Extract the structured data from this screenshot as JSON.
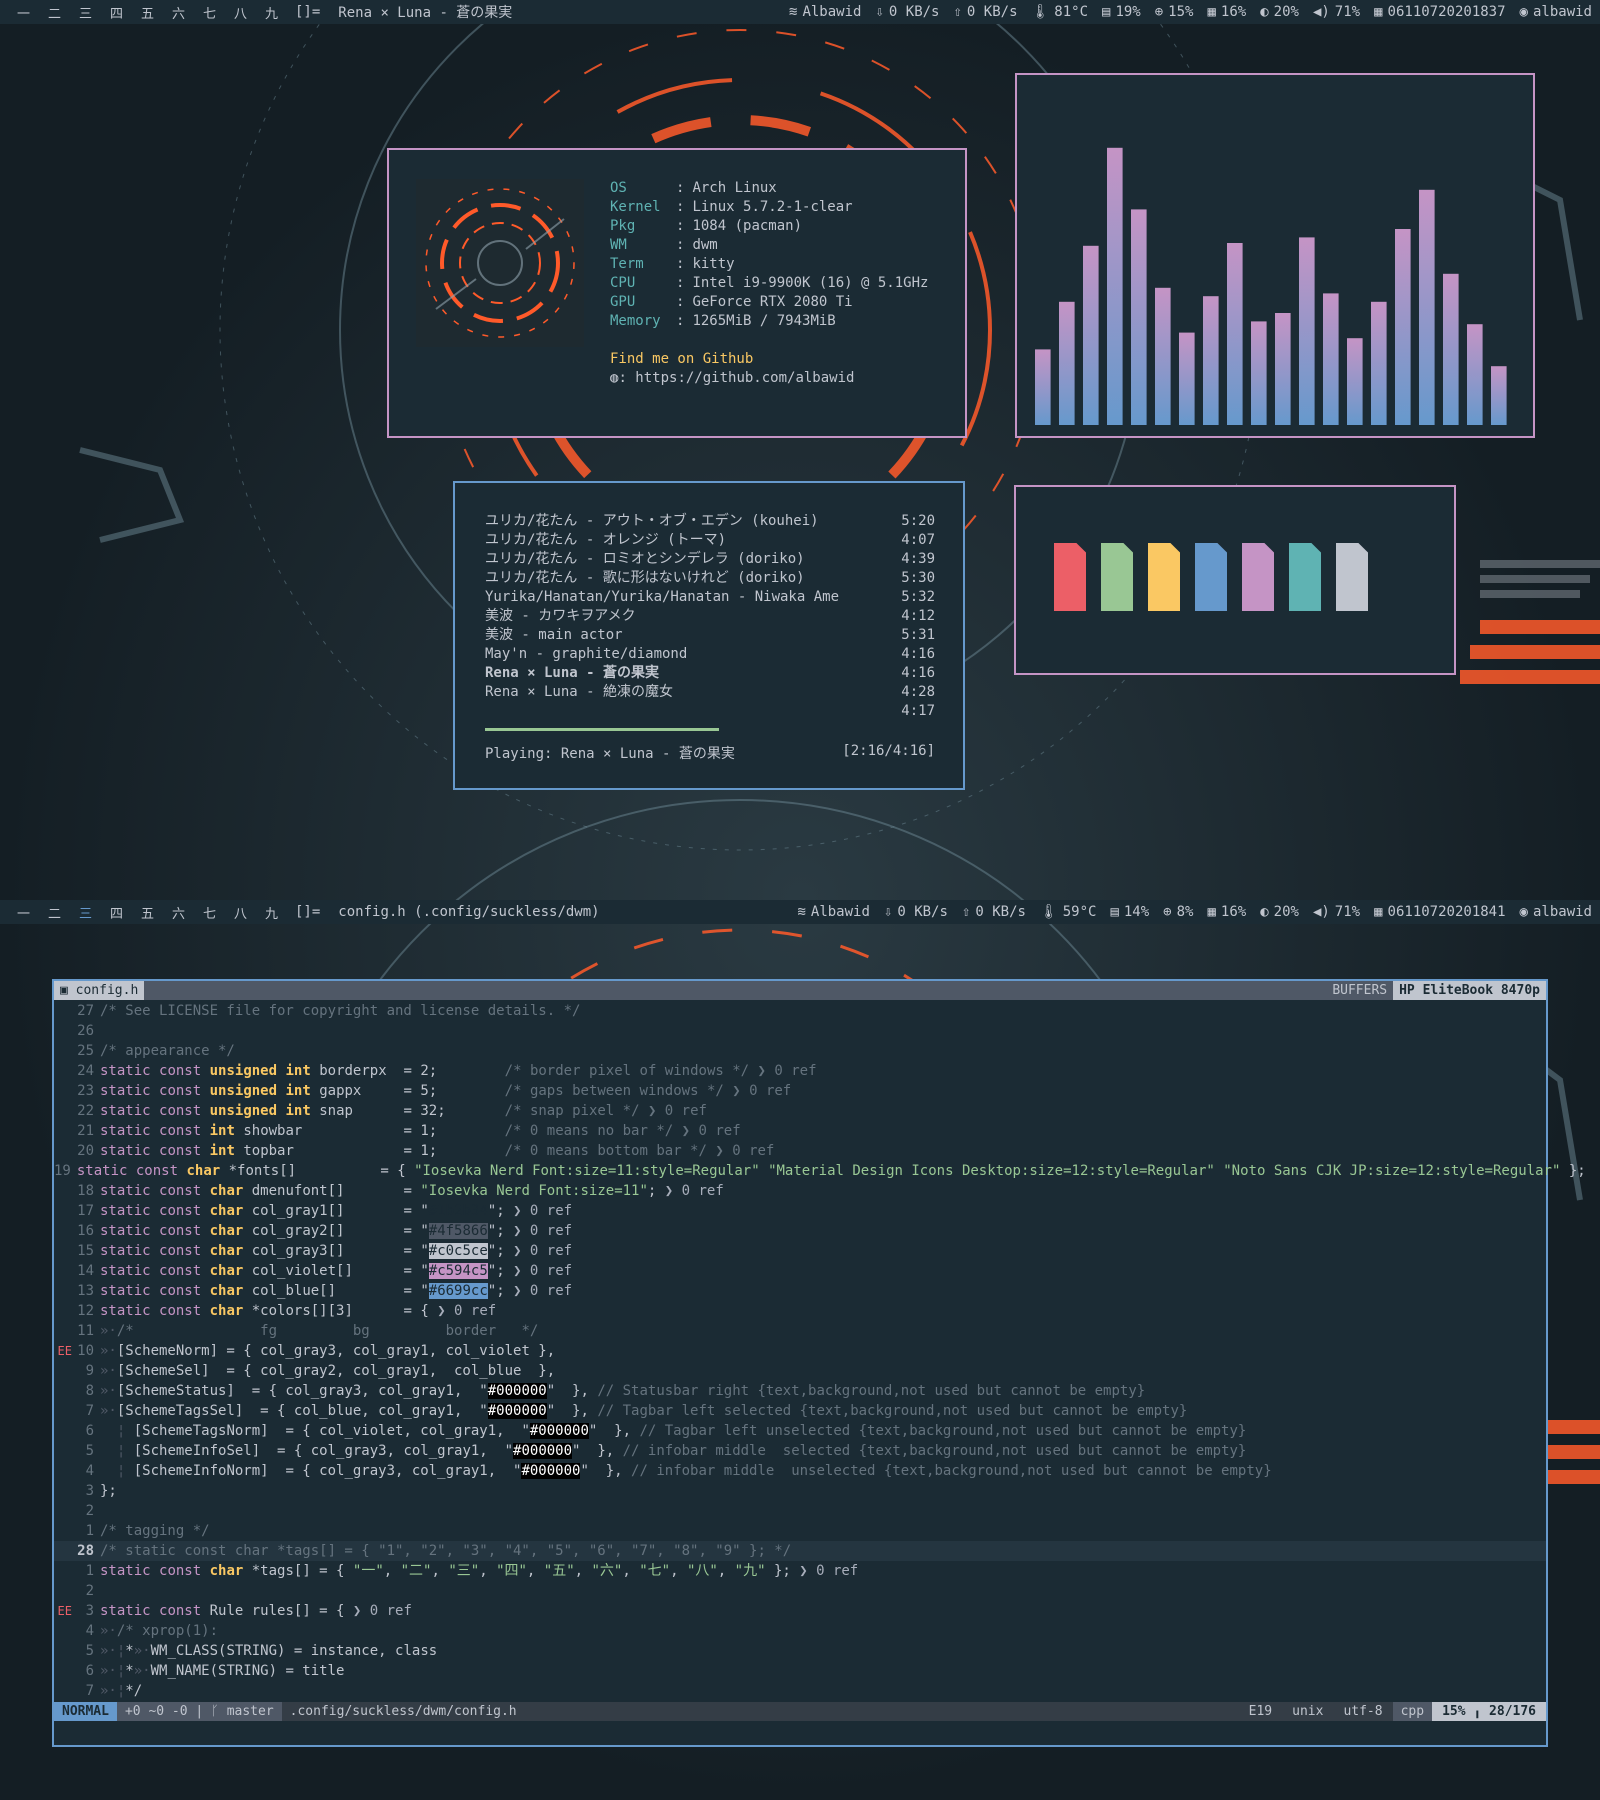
{
  "bar_top": {
    "tags": [
      "一",
      "二",
      "三",
      "四",
      "五",
      "六",
      "七",
      "八",
      "九"
    ],
    "layout": "[]=",
    "title": "Rena × Luna - 蒼の果実",
    "wifi": "Albawid",
    "down": "0 KB/s",
    "up": "0 KB/s",
    "temp": "81°C",
    "mem": "19%",
    "cpu": "15%",
    "disk": "16%",
    "bright": "20%",
    "vol": "71%",
    "date": "06110720201837",
    "user": "albawid"
  },
  "bar_bottom": {
    "tags": [
      "一",
      "二",
      "三",
      "四",
      "五",
      "六",
      "七",
      "八",
      "九"
    ],
    "layout": "[]=",
    "title": "config.h (.config/suckless/dwm)",
    "wifi": "Albawid",
    "down": "0 KB/s",
    "up": "0 KB/s",
    "temp": "59°C",
    "mem": "14%",
    "cpu": "8%",
    "disk": "16%",
    "bright": "20%",
    "vol": "71%",
    "date": "06110720201841",
    "user": "albawid"
  },
  "fetch": {
    "rows": [
      {
        "key": "OS",
        "value": "Arch Linux"
      },
      {
        "key": "Kernel",
        "value": "Linux 5.7.2-1-clear"
      },
      {
        "key": "Pkg",
        "value": "1084 (pacman)"
      },
      {
        "key": "WM",
        "value": "dwm"
      },
      {
        "key": "Term",
        "value": "kitty"
      },
      {
        "key": "CPU",
        "value": "Intel i9-9900K (16) @ 5.1GHz"
      },
      {
        "key": "GPU",
        "value": "GeForce RTX 2080 Ti"
      },
      {
        "key": "Memory",
        "value": "1265MiB / 7943MiB"
      }
    ],
    "sep": ":",
    "github_label": "Find me on Github",
    "github_url": ": https://github.com/albawid"
  },
  "visualizer": {
    "levels": [
      0.27,
      0.44,
      0.64,
      0.99,
      0.77,
      0.49,
      0.33,
      0.46,
      0.65,
      0.37,
      0.4,
      0.67,
      0.47,
      0.31,
      0.44,
      0.7,
      0.84,
      0.54,
      0.36,
      0.21
    ],
    "color_top": "#c594c5",
    "color_bottom": "#6699cc"
  },
  "playlist": {
    "tracks": [
      {
        "title": "ユリカ/花たん - アウト・オブ・エデン (kouhei)",
        "time": "5:20"
      },
      {
        "title": "ユリカ/花たん - オレンジ (トーマ)",
        "time": "4:07"
      },
      {
        "title": "ユリカ/花たん - ロミオとシンデレラ (doriko)",
        "time": "4:39"
      },
      {
        "title": "ユリカ/花たん - 歌に形はないけれど (doriko)",
        "time": "5:30"
      },
      {
        "title": "Yurika/Hanatan/Yurika/Hanatan - Niwaka Ame",
        "time": "5:32"
      },
      {
        "title": "美波 - カワキヲアメク",
        "time": "4:12"
      },
      {
        "title": "美波 - main actor",
        "time": "5:31"
      },
      {
        "title": "May'n - graphite/diamond",
        "time": "4:16"
      },
      {
        "title": "Rena × Luna - 蒼の果実",
        "time": "4:16"
      },
      {
        "title": "Rena × Luna - 絶凍の魔女",
        "time": "4:28"
      },
      {
        "title": "",
        "time": "4:17"
      }
    ],
    "current_index": 8,
    "progress": 0.52,
    "playing": "Playing: Rena × Luna - 蒼の果実",
    "position": "[2:16/4:16]"
  },
  "palette": {
    "colors": [
      "#ec5f67",
      "#99c794",
      "#fac863",
      "#6699cc",
      "#c594c5",
      "#5fb3b3",
      "#c0c5ce"
    ]
  },
  "editor": {
    "tab_file": "config.h",
    "buffers_label": "BUFFERS",
    "host": "HP EliteBook 8470p",
    "lines": [
      {
        "sign": "",
        "num": "27",
        "text": "/* See LICENSE file for copyright and license details. */"
      },
      {
        "sign": "",
        "num": "26",
        "text": ""
      },
      {
        "sign": "",
        "num": "25",
        "text": "/* appearance */"
      },
      {
        "sign": "",
        "num": "24",
        "text": "static const unsigned int borderpx  = 2;        /* border pixel of windows */ ❯ 0 ref"
      },
      {
        "sign": "",
        "num": "23",
        "text": "static const unsigned int gappx     = 5;        /* gaps between windows */ ❯ 0 ref"
      },
      {
        "sign": "",
        "num": "22",
        "text": "static const unsigned int snap      = 32;       /* snap pixel */ ❯ 0 ref"
      },
      {
        "sign": "",
        "num": "21",
        "text": "static const int showbar            = 1;        /* 0 means no bar */ ❯ 0 ref"
      },
      {
        "sign": "",
        "num": "20",
        "text": "static const int topbar             = 1;        /* 0 means bottom bar */ ❯ 0 ref"
      },
      {
        "sign": "",
        "num": "19",
        "text": "static const char *fonts[]          = { \"Iosevka Nerd Font:size=11:style=Regular\" \"Material Design Icons Desktop:size=12:style=Regular\" \"Noto Sans CJK JP:size=12:style=Regular\" };"
      },
      {
        "sign": "",
        "num": "18",
        "text": "static const char dmenufont[]       = \"Iosevka Nerd Font:size=11\"; ❯ 0 ref"
      },
      {
        "sign": "",
        "num": "17",
        "text": "static const char col_gray1[]       = \"#1b2b34\"; ❯ 0 ref"
      },
      {
        "sign": "",
        "num": "16",
        "text": "static const char col_gray2[]       = \"#4f5866\"; ❯ 0 ref"
      },
      {
        "sign": "",
        "num": "15",
        "text": "static const char col_gray3[]       = \"#c0c5ce\"; ❯ 0 ref"
      },
      {
        "sign": "",
        "num": "14",
        "text": "static const char col_violet[]      = \"#c594c5\"; ❯ 0 ref"
      },
      {
        "sign": "",
        "num": "13",
        "text": "static const char col_blue[]        = \"#6699cc\"; ❯ 0 ref"
      },
      {
        "sign": "",
        "num": "12",
        "text": "static const char *colors[][3]      = { ❯ 0 ref"
      },
      {
        "sign": "",
        "num": "11",
        "text": "»·/*               fg         bg         border   */"
      },
      {
        "sign": "EE",
        "num": "10",
        "text": "»·[SchemeNorm] = { col_gray3, col_gray1, col_violet },"
      },
      {
        "sign": "",
        "num": "9",
        "text": "»·[SchemeSel]  = { col_gray2, col_gray1,  col_blue  },"
      },
      {
        "sign": "",
        "num": "8",
        "text": "»·[SchemeStatus]  = { col_gray3, col_gray1,  \"#000000\"  }, // Statusbar right {text,background,not used but cannot be empty}"
      },
      {
        "sign": "",
        "num": "7",
        "text": "»·[SchemeTagsSel]  = { col_blue, col_gray1,  \"#000000\"  }, // Tagbar left selected {text,background,not used but cannot be empty}"
      },
      {
        "sign": "",
        "num": "6",
        "text": "  ¦ [SchemeTagsNorm]  = { col_violet, col_gray1,  \"#000000\"  }, // Tagbar left unselected {text,background,not used but cannot be empty}"
      },
      {
        "sign": "",
        "num": "5",
        "text": "  ¦ [SchemeInfoSel]  = { col_gray3, col_gray1,  \"#000000\"  }, // infobar middle  selected {text,background,not used but cannot be empty}"
      },
      {
        "sign": "",
        "num": "4",
        "text": "  ¦ [SchemeInfoNorm]  = { col_gray3, col_gray1,  \"#000000\"  }, // infobar middle  unselected {text,background,not used but cannot be empty}"
      },
      {
        "sign": "",
        "num": "3",
        "text": "};"
      },
      {
        "sign": "",
        "num": "2",
        "text": ""
      },
      {
        "sign": "",
        "num": "1",
        "text": "/* tagging */"
      },
      {
        "sign": "",
        "num": "28",
        "text": "/* static const char *tags[] = { \"1\", \"2\", \"3\", \"4\", \"5\", \"6\", \"7\", \"8\", \"9\" }; */"
      },
      {
        "sign": "",
        "num": "1",
        "text": "static const char *tags[] = { \"一\", \"二\", \"三\", \"四\", \"五\", \"六\", \"七\", \"八\", \"九\" }; ❯ 0 ref"
      },
      {
        "sign": "",
        "num": "2",
        "text": ""
      },
      {
        "sign": "EE",
        "num": "3",
        "text": "static const Rule rules[] = { ❯ 0 ref"
      },
      {
        "sign": "",
        "num": "4",
        "text": "»·/* xprop(1):"
      },
      {
        "sign": "",
        "num": "5",
        "text": "»·¦*»·WM_CLASS(STRING) = instance, class"
      },
      {
        "sign": "",
        "num": "6",
        "text": "»·¦*»·WM_NAME(STRING) = title"
      },
      {
        "sign": "",
        "num": "7",
        "text": "»·¦*/"
      }
    ],
    "current_line_index": 27,
    "status": {
      "mode": "NORMAL",
      "git": "+0 ~0 -0 | ᚴ master",
      "file": ".config/suckless/dwm/config.h",
      "errors": "E19",
      "format": "unix",
      "encoding": "utf-8",
      "filetype": "cpp",
      "position": "15% ╻ 28/176"
    }
  }
}
